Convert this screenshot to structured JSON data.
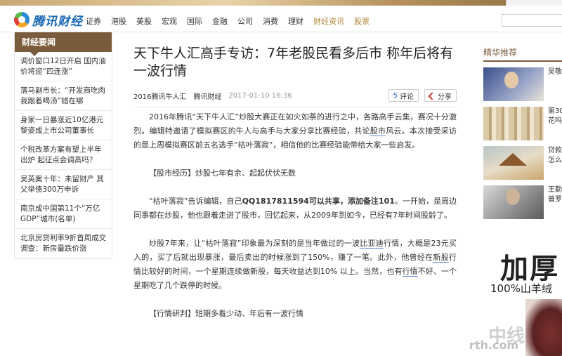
{
  "header": {
    "logo_text": "腾讯财经",
    "nav": [
      "证券",
      "港股",
      "美股",
      "宏观",
      "国际",
      "金融",
      "公司",
      "消费",
      "理财"
    ],
    "nav_sub": [
      "财经资讯",
      "股票"
    ]
  },
  "sidebar": {
    "title": "财经要闻",
    "items": [
      "调价窗口12日开启 国内油价将迎“四连涨”",
      "落马副市长：“开发商吃肉我跟着喝汤”错在哪",
      "身家一日暴涨近10亿港元 黎姿成上市公司董事长",
      "个税改革方案有望上半年出炉 起征点会调高吗？",
      "吴英案十年：未留财产 其父举债300万申诉",
      "南京成中国第11个“万亿GDP”城市(名单)",
      "北京房贷利率9折首周成交调查：新房量跌价涨"
    ]
  },
  "article": {
    "title": "天下牛人汇高手专访：7年老股民看多后市 称年后将有一波行情",
    "author": "2016腾讯牛人汇",
    "source": "腾讯财经",
    "time": "2017-01-10 16:36",
    "comment_count": "5",
    "comment_label": "评论",
    "share_label": "分享",
    "p1_a": "2016年腾讯“天下牛人汇”炒股大赛正在如火如荼的进行之中，各路高手云集，赛况十分激烈。编辑特邀请了模拟赛区的牛人与高手与大家分享比赛经验，共论",
    "p1_link": "股市",
    "p1_b": "风云。本次接受采访的是上周模拟赛区前五名选手“枯叶落寂”，相信他的比赛经验能带给大家一些启发。",
    "sec1": "【股市经历】炒股七年有余、起起伏伏无数",
    "p2_a": "“枯叶落寂”告诉编辑，自己",
    "p2_qq": "QQ1817811594可以共享，添加备注101",
    "p2_b": "。一开始，是周边同事都在炒股，他也跟着走进了股市，回忆起来，从2009年到如今，已经有7年时间股龄了。",
    "p3_a": "炒股7年来，让“枯叶落寂”印象最为深刻的是当年做过的一波",
    "p3_link": "比亚迪",
    "p3_b": "行情，大概是23元买入的，买了后就出现暴涨，最后卖出的时候涨到了150%，赚了一笔。此外，他曾经在",
    "p3_link2": "新股",
    "p3_c": "行情比较好的时间，一个星期连续做新股，每天收益达到10% 以上。当然，也有",
    "p3_link3": "行情",
    "p3_d": "不好、一个星期吃了几个跌停的时候。",
    "sec2": "【行情研判】短期多看少动、年后有一波行情"
  },
  "right": {
    "title": "精华推荐",
    "items": [
      "吴敬",
      "第30",
      "花吗",
      "贷款",
      "怎么",
      "王勤",
      "普罗"
    ]
  },
  "ad": {
    "big_a": "加厚",
    "big_b": "",
    "sub": "100%山羊绒"
  },
  "watermark": {
    "line1": "中线",
    "line2": "rth.com"
  }
}
